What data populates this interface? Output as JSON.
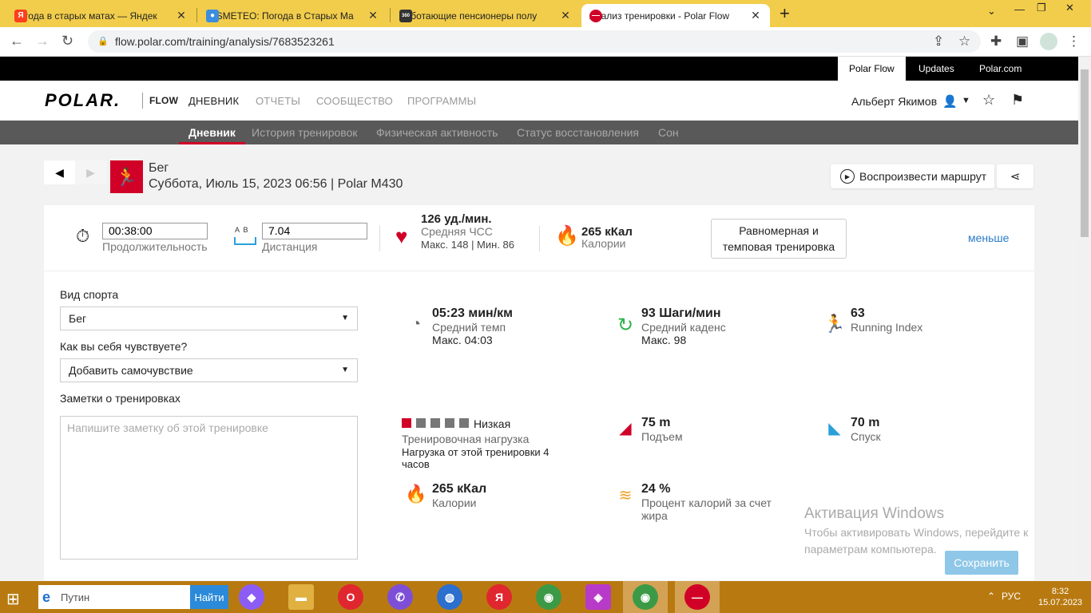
{
  "browser": {
    "tabs": [
      {
        "title": "погода в старых матах — Яндек",
        "icon": "yandex-icon",
        "color": "#fc3f1d",
        "glyph": "Я"
      },
      {
        "title": "GISMETEO: Погода в Старых Ма",
        "icon": "gismeteo-icon",
        "color": "#3b8de0",
        "glyph": "●"
      },
      {
        "title": "Работающие пенсионеры полу",
        "icon": "news-icon",
        "color": "#333333",
        "glyph": "360"
      },
      {
        "title": "Анализ тренировки - Polar Flow",
        "icon": "polar-icon",
        "color": "#d10027",
        "glyph": "—"
      }
    ],
    "url": "flow.polar.com/training/analysis/7683523261"
  },
  "polar": {
    "top_links": [
      "Polar Flow",
      "Updates",
      "Polar.com"
    ],
    "logo": "POLAR.",
    "flow_label": "FLOW",
    "nav": [
      "ДНЕВНИК",
      "ОТЧЕТЫ",
      "СООБЩЕСТВО",
      "ПРОГРАММЫ"
    ],
    "user_name": "Альберт Якимов",
    "subnav": [
      "Дневник",
      "История тренировок",
      "Физическая активность",
      "Статус восстановления",
      "Сон"
    ]
  },
  "training": {
    "sport": "Бег",
    "subtitle": "Суббота, Июль 15, 2023 06:56 | Polar M430",
    "route_button": "Воспроизвести маршрут"
  },
  "summary": {
    "duration_value": "00:38:00",
    "duration_label": "Продолжительность",
    "distance_ab": "A  B",
    "distance_value": "7.04",
    "distance_label": "Дистанция",
    "hr_value": "126 уд./мин.",
    "hr_label": "Средняя ЧСС",
    "hr_minmax": "Макс. 148  |  Мин. 86",
    "cal_value": "265 кКал",
    "cal_label": "Калории",
    "type_button": "Равномерная и темповая тренировка",
    "less_link": "меньше"
  },
  "form": {
    "sport_label": "Вид спорта",
    "sport_value": "Бег",
    "feeling_label": "Как вы себя чувствуете?",
    "feeling_value": "Добавить самочувствие",
    "notes_label": "Заметки о тренировках",
    "notes_placeholder": "Напишите заметку об этой тренировке"
  },
  "stats": {
    "pace_value": "05:23 мин/км",
    "pace_label": "Средний темп",
    "pace_max": "Макс. 04:03",
    "cadence_value": "93 Шаги/мин",
    "cadence_label": "Средний каденс",
    "cadence_max": "Макс. 98",
    "ri_value": "63",
    "ri_label": "Running Index",
    "load_level": "Низкая",
    "load_level_filled": 1,
    "load_level_total": 5,
    "load_label": "Тренировочная нагрузка",
    "load_desc": "Нагрузка от этой тренировки 4 часов",
    "ascent_value": "75 m",
    "ascent_label": "Подъем",
    "descent_value": "70 m",
    "descent_label": "Спуск",
    "cal_value": "265 кКал",
    "cal_label": "Калории",
    "fat_value": "24 %",
    "fat_label": "Процент калорий за счет жира"
  },
  "save_button": "Сохранить",
  "watermark": {
    "title": "Активация Windows",
    "text": "Чтобы активировать Windows, перейдите к параметрам компьютера."
  },
  "taskbar": {
    "search_placeholder": "Путин",
    "search_button": "Найти",
    "lang": "РУС",
    "time": "8:32",
    "date": "15.07.2023"
  }
}
